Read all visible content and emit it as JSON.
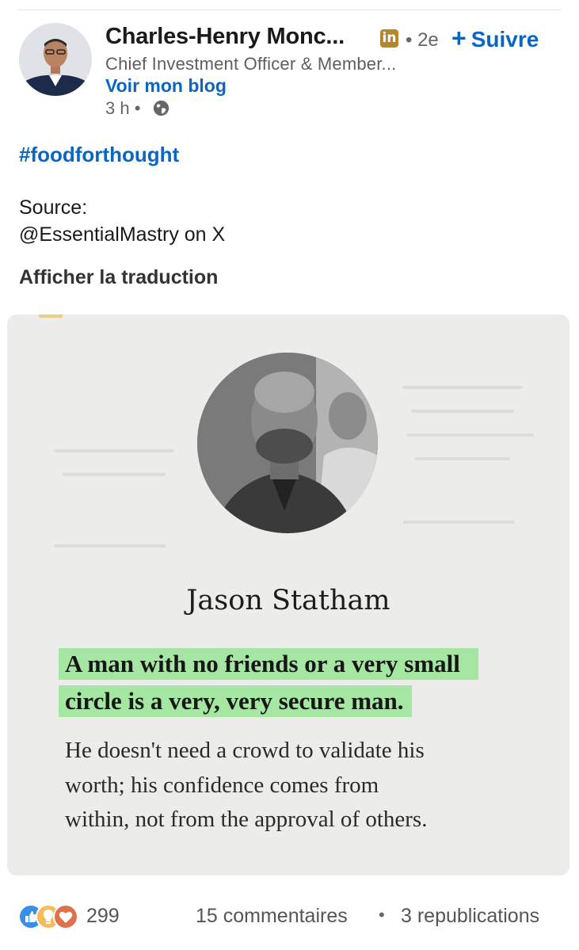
{
  "post": {
    "author": {
      "name": "Charles-Henry Monc...",
      "badge": "in",
      "degree": "• 2e",
      "headline": "Chief Investment Officer & Member...",
      "blog_link": "Voir mon blog",
      "time": "3 h •"
    },
    "follow": {
      "plus": "+",
      "label": "Suivre"
    },
    "hashtag": "#foodforthought",
    "source_label": "Source:",
    "source_value": "@EssentialMastry on X",
    "translate": "Afficher la traduction",
    "image": {
      "name": "Jason Statham",
      "highlight_line1": "A man with no friends or a very small",
      "highlight_line2": "circle is a very, very secure man.",
      "body_line1": "He doesn't need a crowd to validate his",
      "body_line2": "worth; his confidence comes from",
      "body_line3": "within, not from the approval of others."
    },
    "stats": {
      "reactions": "299",
      "comments": "15 commentaires",
      "separator": "•",
      "reposts": "3 republications"
    }
  },
  "colors": {
    "link_blue": "#0a66c2",
    "highlight_green": "#a6e6a3",
    "badge_gold": "#b6862c"
  },
  "icons": {
    "globe": "globe-icon",
    "reactions": [
      "like-icon",
      "insightful-icon",
      "love-icon"
    ]
  }
}
